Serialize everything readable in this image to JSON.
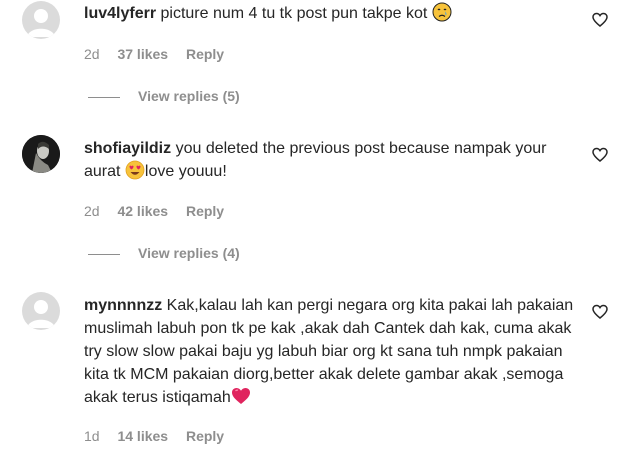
{
  "comments": [
    {
      "username": "luv4lyferr",
      "text": "picture num 4 tu tk post pun takpe kot",
      "emoji": "crying-face",
      "time": "2d",
      "likes": "37 likes",
      "reply": "Reply",
      "view_replies": "View replies (5)"
    },
    {
      "username": "shofiayildiz",
      "text_before": "you deleted the previous post because nampak your aurat",
      "emoji": "heart-eyes-face",
      "text_after": "love youuu!",
      "time": "2d",
      "likes": "42 likes",
      "reply": "Reply",
      "view_replies": "View replies (4)"
    },
    {
      "username": "mynnnnzz",
      "text": "Kak,kalau lah kan pergi negara org kita pakai lah pakaian muslimah labuh pon tk pe kak ,akak dah Cantek dah kak, cuma akak try slow slow pakai baju yg labuh biar org kt sana tuh nmpk pakaian kita tk MCM pakaian diorg,better akak delete gambar akak ,semoga akak terus istiqamah",
      "emoji": "red-heart",
      "time": "1d",
      "likes": "14 likes",
      "reply": "Reply"
    }
  ],
  "colors": {
    "text": "#262626",
    "secondary": "#8e8e8e",
    "avatar_placeholder": "#dbdbdb"
  }
}
